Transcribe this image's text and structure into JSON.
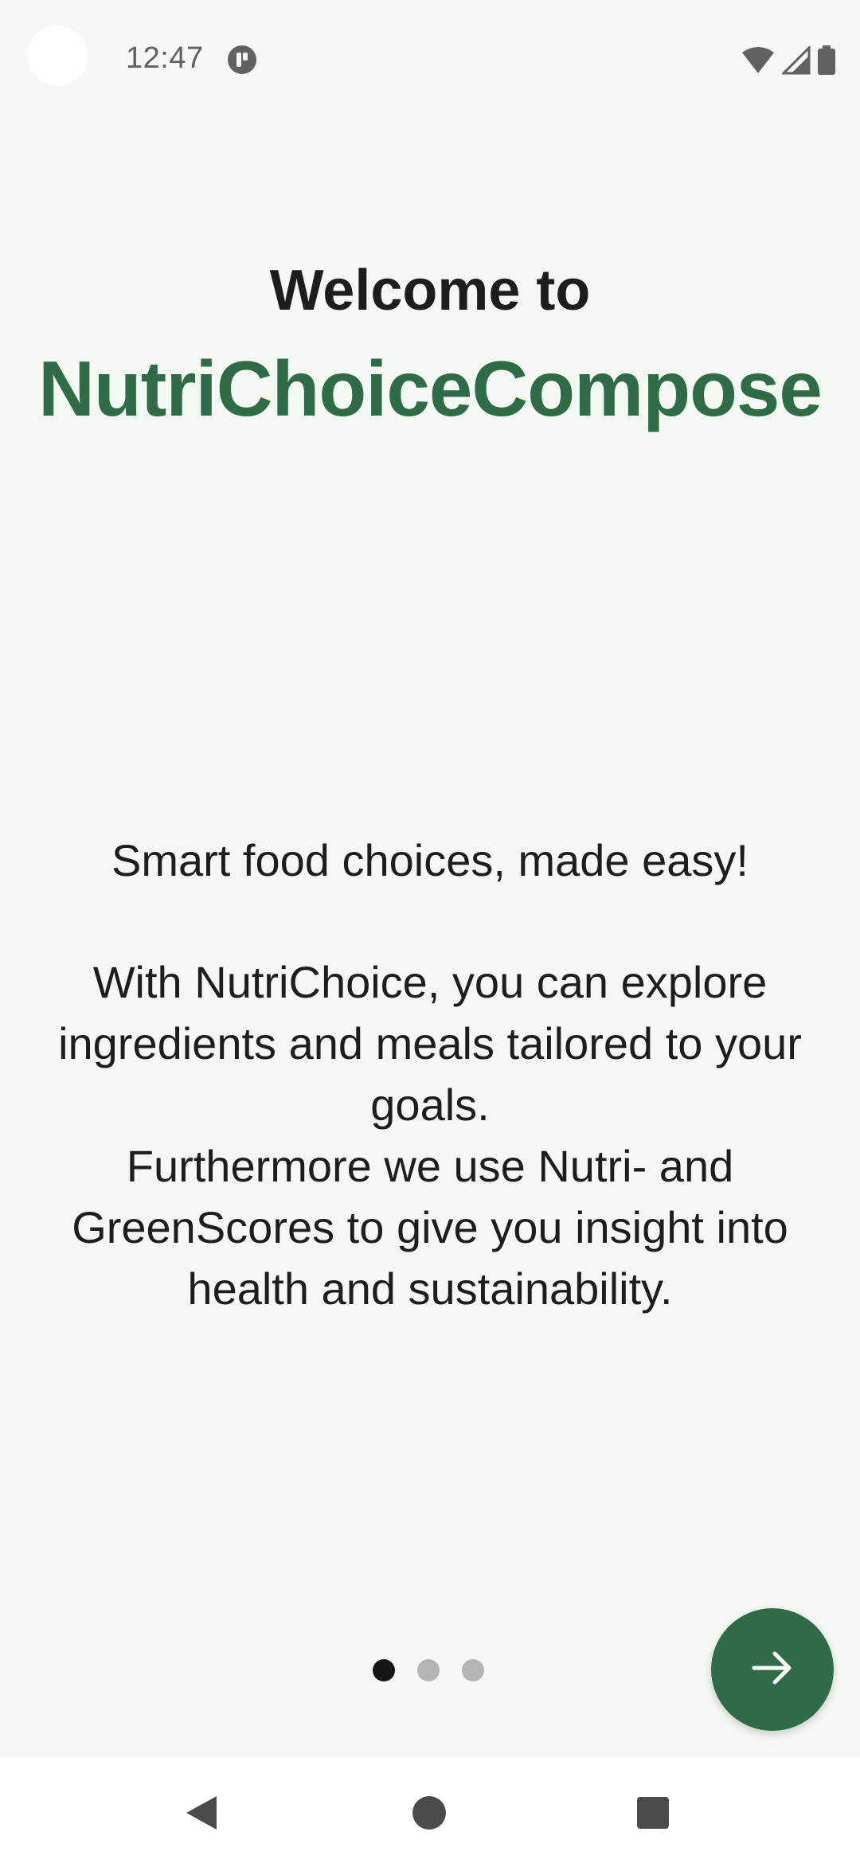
{
  "status_bar": {
    "time": "12:47",
    "icons": [
      "app-notification-icon",
      "wifi-icon",
      "cell-signal-icon",
      "battery-icon"
    ]
  },
  "onboarding": {
    "welcome": "Welcome to",
    "app_name": "NutriChoiceCompose",
    "tagline": "Smart food choices, made easy!",
    "description": "With NutriChoice, you can explore ingredients and meals tailored to your goals.\nFurthermore we use Nutri- and GreenScores to give you insight into health and sustainability.",
    "page_count": 3,
    "current_page": 1
  },
  "fab": {
    "icon": "arrow-forward-icon"
  },
  "nav_bar": {
    "buttons": [
      "back-icon",
      "home-icon",
      "recents-icon"
    ]
  },
  "colors": {
    "background": "#f4f8f2",
    "brand_green": "#2e6b46",
    "text_dark": "#1b1f1b",
    "dot_inactive": "#b2b6b1",
    "dot_active": "#141814"
  }
}
